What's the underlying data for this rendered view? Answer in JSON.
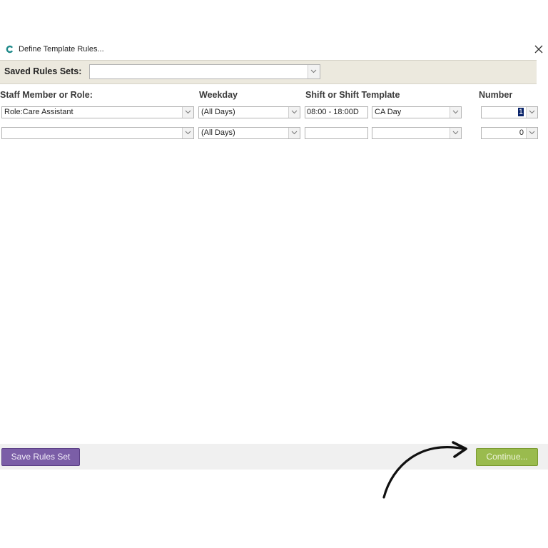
{
  "window": {
    "title": "Define Template Rules...",
    "close_glyph": "✕"
  },
  "saved_rules": {
    "label": "Saved Rules Sets:",
    "value": ""
  },
  "columns": {
    "staff": "Staff Member or Role:",
    "weekday": "Weekday",
    "shift": "Shift or Shift Template",
    "number": "Number"
  },
  "rows": [
    {
      "staff": "Role:Care Assistant",
      "weekday": "(All Days)",
      "shift_time": "08:00 - 18:00D",
      "template": "CA Day",
      "number": "1"
    },
    {
      "staff": "",
      "weekday": "(All Days)",
      "shift_time": "",
      "template": "",
      "number": "0"
    }
  ],
  "footer": {
    "save_label": "Save Rules Set",
    "continue_label": "Continue..."
  },
  "colors": {
    "save_button": "#7b5ea7",
    "continue_button": "#9abb4e",
    "header_bar": "#ece9de"
  },
  "icons": [
    "app-logo-icon",
    "close-icon",
    "chevron-down-icon",
    "curved-arrow-icon"
  ]
}
